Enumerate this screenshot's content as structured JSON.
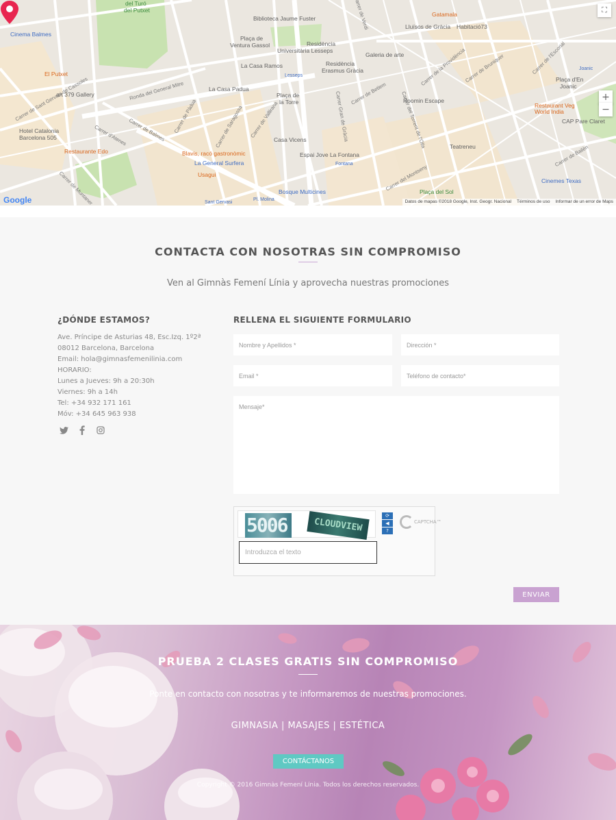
{
  "map": {
    "labels": {
      "cinema_balmes": "Cinema Balmes",
      "el_putxet": "El Putxet",
      "art_379": "art 379 Gallery",
      "hotel_catalonia": "Hotel Catalonia",
      "hotel_catalonia_2": "Barcelona 505",
      "restaurante_edo": "Restaurante Edo",
      "biblioteca": "Biblioteca Jaume Fuster",
      "placa_ventura": "Plaça de",
      "placa_ventura_2": "Ventura Gassol",
      "residencia": "Residència",
      "residencia_2": "Universitària Lesseps",
      "la_casa_ramos": "La Casa Ramos",
      "la_casa_padua": "La Casa Padua",
      "placa_torre": "Plaça de",
      "placa_torre_2": "la Torre",
      "lesseps": "Lesseps",
      "residencia_erasmus": "Residència",
      "residencia_erasmus_2": "Erasmus Gràcia",
      "galeria": "Galeria de arte",
      "gatamala": "Gatamala",
      "lluisos": "Lluïsos de Gràcia",
      "habitacio73": "Habitació73",
      "roomin": "Roomin Escape",
      "casa_vicens": "Casa Vicens",
      "blavis": "Blavis, racó gastronòmic",
      "la_general": "La General Surfera",
      "usagui": "Usagui",
      "espai_jove": "Espai Jove La Fontana",
      "fontana": "Fontana",
      "bosque": "Bosque Multicines",
      "teatreneu": "Teatreneu",
      "placa_sol": "Plaça del Sol",
      "veg_world": "Restaurant Veg",
      "veg_world_2": "World India",
      "cap_pare": "CAP Pare Claret",
      "placa_joanic": "Plaça d'En",
      "placa_joanic_2": "Joanic",
      "joanic": "Joanic",
      "cinemes_texas": "Cinemes Texas",
      "sant_gervasi": "Sant Gervasi",
      "pl_molina": "Pl. Molina",
      "turo": "del Turó",
      "turo_2": "del Putxet",
      "ronda": "Ronda del General Mitre",
      "c_balmes": "Carrer de Balmes",
      "c_atenes": "Carrer d'Atenes",
      "c_padua": "Carrer de Pàdua",
      "c_verdi": "Carrer de Verdi",
      "c_provenca": "Carrer de la Providència",
      "c_bailen": "Carrer de Bailèn",
      "c_escorial": "Carrer de l'Escorial",
      "c_gran_gracia": "Carrer Gran de Gràcia",
      "c_torrent_olla": "Carrer del Torrent de l'Olla",
      "c_montseny": "Carrer del Montseny",
      "c_muntaner": "Carrer de Muntaner",
      "c_sant_gervasi": "Carrer de Sant Gervasi de Cassoles",
      "c_saragossa": "Carrer de Saragossa",
      "c_vallirana": "Carrer de Vallirana",
      "c_bethlem": "Carrer de Betlem",
      "c_bruniquer": "Carrer de Bruniquer"
    },
    "zoom_in": "+",
    "zoom_out": "−",
    "google": "Google",
    "footer": {
      "data": "Datos de mapas ©2018 Google, Inst. Geogr. Nacional",
      "terms": "Términos de uso",
      "report": "Informar de un error de Maps"
    }
  },
  "contact": {
    "title": "CONTACTA CON NOSOTRAS SIN COMPROMISO",
    "subtitle": "Ven al Gimnàs Femení Línia y aprovecha nuestras promociones",
    "where_title": "¿DÓNDE ESTAMOS?",
    "address_lines": [
      "Ave. Príncipe de Asturias 48, Esc.Izq. 1º2ª",
      "08012 Barcelona, Barcelona",
      "Email: hola@gimnasfemenilinia.com",
      "HORARIO:",
      "Lunes a Jueves: 9h a 20:30h",
      "Viernes: 9h a 14h",
      "Tel: +34 932 171 161",
      "Móv: +34 645 963 938"
    ],
    "form_title": "RELLENA EL SIGUIENTE FORMULARIO",
    "fields": {
      "name": "Nombre y Apellidos *",
      "address": "Dirección *",
      "email": "Email *",
      "phone": "Teléfono de contacto*",
      "message": "Mensaje*"
    },
    "captcha": {
      "text_left": "5006",
      "text_right": "CLOUDVIEW",
      "placeholder": "Introduzca el texto",
      "logo": "CAPTCHA™"
    },
    "send": "ENVIAR"
  },
  "hero": {
    "title": "PRUEBA 2 CLASES GRATIS SIN COMPROMISO",
    "subtitle": "Ponte en contacto con nosotras y te informaremos de nuestras promociones.",
    "services": "GIMNASIA | MASAJES | ESTÉTICA",
    "button": "CONTÁCTANOS",
    "copyright": "Copyright © 2016 Gimnàs Femení Línia. Todos los derechos reservados."
  },
  "colors": {
    "accent_purple": "#c9a2d1",
    "accent_teal": "#5fc9c3",
    "pin_red": "#e8264f"
  }
}
